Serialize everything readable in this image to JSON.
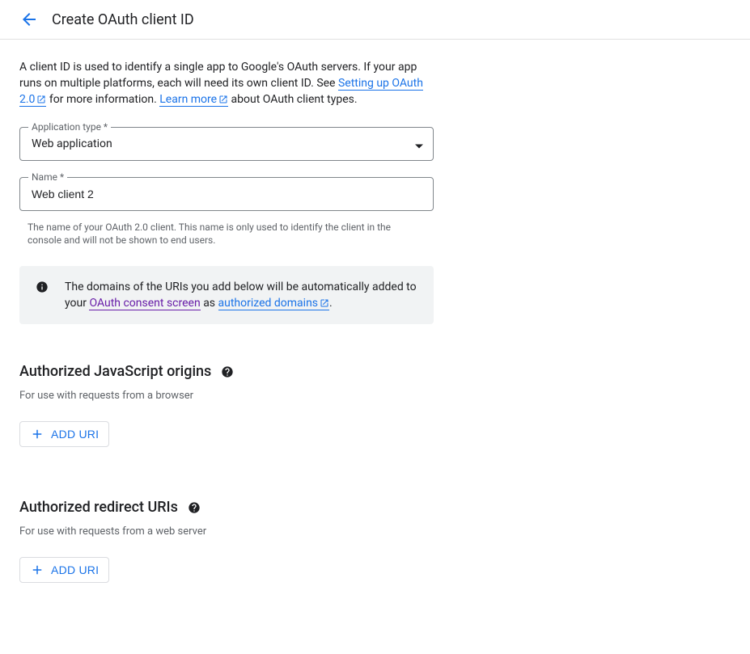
{
  "header": {
    "title": "Create OAuth client ID"
  },
  "intro": {
    "text1": "A client ID is used to identify a single app to Google's OAuth servers. If your app runs on multiple platforms, each will need its own client ID. See ",
    "link1": "Setting up OAuth 2.0",
    "text2": " for more information. ",
    "link2": "Learn more",
    "text3": " about OAuth client types."
  },
  "fields": {
    "app_type": {
      "label": "Application type *",
      "value": "Web application"
    },
    "name": {
      "label": "Name *",
      "value": "Web client 2",
      "helper": "The name of your OAuth 2.0 client. This name is only used to identify the client in the console and will not be shown to end users."
    }
  },
  "info_box": {
    "text1": "The domains of the URIs you add below will be automatically added to your ",
    "link1": "OAuth consent screen",
    "text2": " as ",
    "link2": "authorized domains",
    "text3": "."
  },
  "sections": {
    "js_origins": {
      "title": "Authorized JavaScript origins",
      "subtitle": "For use with requests from a browser",
      "button": "ADD URI"
    },
    "redirect_uris": {
      "title": "Authorized redirect URIs",
      "subtitle": "For use with requests from a web server",
      "button": "ADD URI"
    }
  }
}
